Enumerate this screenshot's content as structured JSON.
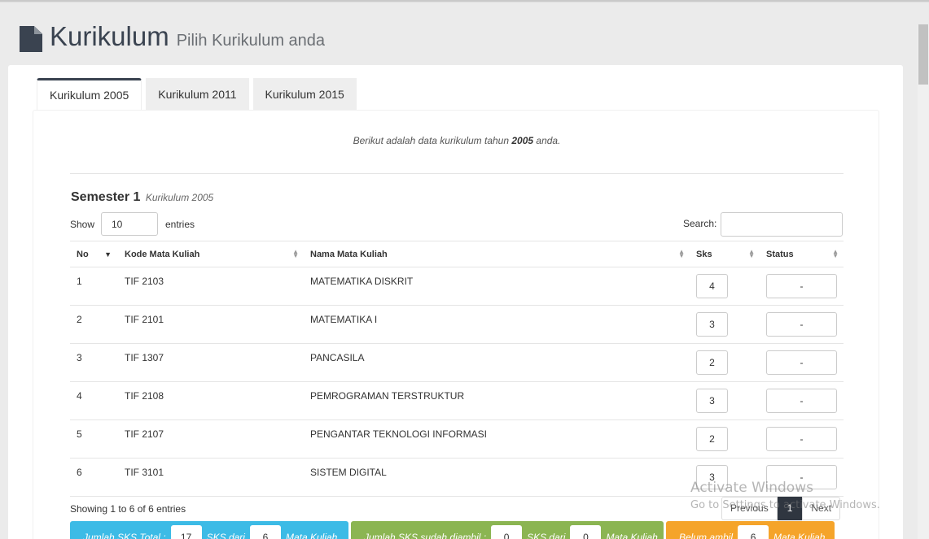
{
  "page": {
    "title": "Kurikulum",
    "subtitle": "Pilih Kurikulum anda"
  },
  "tabs": [
    {
      "label": "Kurikulum 2005",
      "active": true
    },
    {
      "label": "Kurikulum 2011",
      "active": false
    },
    {
      "label": "Kurikulum 2015",
      "active": false
    }
  ],
  "intro": {
    "prefix": "Berikut adalah data kurikulum tahun ",
    "year": "2005",
    "suffix": " anda."
  },
  "semester": {
    "title": "Semester 1",
    "subtitle": "Kurikulum 2005"
  },
  "length": {
    "show_label": "Show",
    "value": "10",
    "entries_label": "entries"
  },
  "search": {
    "label": "Search:",
    "value": ""
  },
  "table": {
    "headers": [
      "No",
      "Kode Mata Kuliah",
      "Nama Mata Kuliah",
      "Sks",
      "Status"
    ],
    "rows": [
      {
        "no": "1",
        "kode": "TIF 2103",
        "nama": "MATEMATIKA DISKRIT",
        "sks": "4",
        "status": "-"
      },
      {
        "no": "2",
        "kode": "TIF 2101",
        "nama": "MATEMATIKA I",
        "sks": "3",
        "status": "-"
      },
      {
        "no": "3",
        "kode": "TIF 1307",
        "nama": "PANCASILA",
        "sks": "2",
        "status": "-"
      },
      {
        "no": "4",
        "kode": "TIF 2108",
        "nama": "PEMROGRAMAN TERSTRUKTUR",
        "sks": "3",
        "status": "-"
      },
      {
        "no": "5",
        "kode": "TIF 2107",
        "nama": "PENGANTAR TEKNOLOGI INFORMASI",
        "sks": "2",
        "status": "-"
      },
      {
        "no": "6",
        "kode": "TIF 3101",
        "nama": "SISTEM DIGITAL",
        "sks": "3",
        "status": "-"
      }
    ]
  },
  "info": "Showing 1 to 6 of 6 entries",
  "pagination": {
    "previous": "Previous",
    "current": "1",
    "next": "Next"
  },
  "stats": {
    "total": {
      "label1": "Jumlah SKS Total :",
      "sks": "17",
      "label2": "SKS dari",
      "mk": "6",
      "label3": "Mata Kuliah"
    },
    "taken": {
      "label1": "Jumlah SKS sudah diambil :",
      "sks": "0",
      "label2": "SKS dari",
      "mk": "0",
      "label3": "Mata Kuliah"
    },
    "pending": {
      "label1": "Belum ambil",
      "mk": "6",
      "label3": "Mata Kuliah"
    }
  },
  "watermark": {
    "line1": "Activate Windows",
    "line2": "Go to Settings to activate Windows."
  },
  "colors": {
    "dark": "#3a4350",
    "blue": "#3cbbe6",
    "green": "#8bb552",
    "orange": "#f5a42a"
  }
}
